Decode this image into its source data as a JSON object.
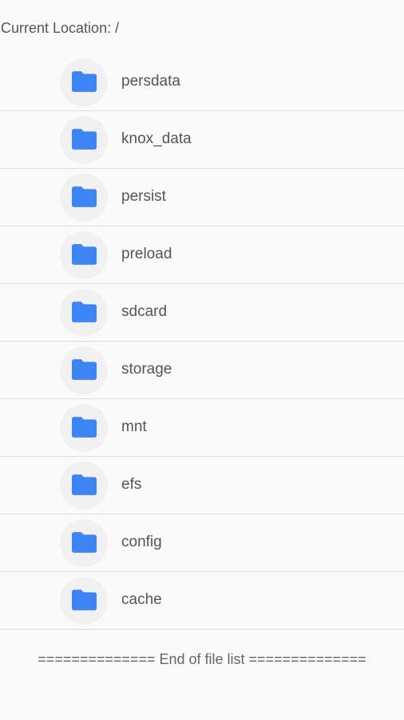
{
  "location": {
    "text": "Current Location: /"
  },
  "files": [
    {
      "name": "persdata",
      "icon": "folder-icon"
    },
    {
      "name": "knox_data",
      "icon": "folder-icon"
    },
    {
      "name": "persist",
      "icon": "folder-icon"
    },
    {
      "name": "preload",
      "icon": "folder-icon"
    },
    {
      "name": "sdcard",
      "icon": "folder-icon"
    },
    {
      "name": "storage",
      "icon": "folder-icon"
    },
    {
      "name": "mnt",
      "icon": "folder-icon"
    },
    {
      "name": "efs",
      "icon": "folder-icon"
    },
    {
      "name": "config",
      "icon": "folder-icon"
    },
    {
      "name": "cache",
      "icon": "folder-icon"
    }
  ],
  "footer": {
    "end_text": "============== End of file list =============="
  },
  "colors": {
    "folder": "#3d84f5",
    "background": "#fafafa",
    "divider": "#dedede",
    "text": "#555555"
  }
}
